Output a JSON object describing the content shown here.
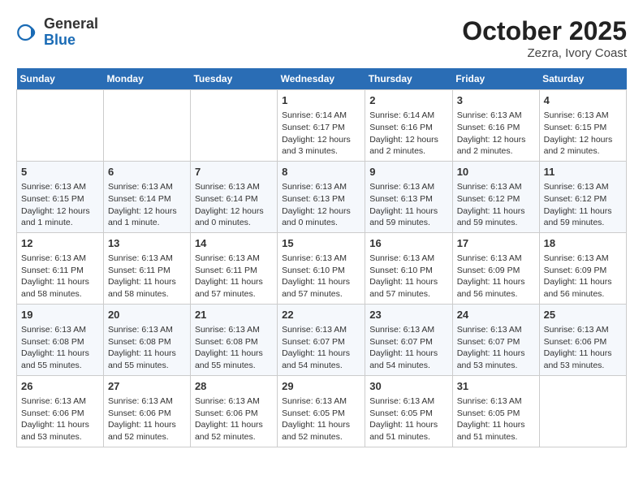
{
  "header": {
    "logo_general": "General",
    "logo_blue": "Blue",
    "month": "October 2025",
    "location": "Zezra, Ivory Coast"
  },
  "days_of_week": [
    "Sunday",
    "Monday",
    "Tuesday",
    "Wednesday",
    "Thursday",
    "Friday",
    "Saturday"
  ],
  "weeks": [
    [
      {
        "day": "",
        "info": ""
      },
      {
        "day": "",
        "info": ""
      },
      {
        "day": "",
        "info": ""
      },
      {
        "day": "1",
        "info": "Sunrise: 6:14 AM\nSunset: 6:17 PM\nDaylight: 12 hours and 3 minutes."
      },
      {
        "day": "2",
        "info": "Sunrise: 6:14 AM\nSunset: 6:16 PM\nDaylight: 12 hours and 2 minutes."
      },
      {
        "day": "3",
        "info": "Sunrise: 6:13 AM\nSunset: 6:16 PM\nDaylight: 12 hours and 2 minutes."
      },
      {
        "day": "4",
        "info": "Sunrise: 6:13 AM\nSunset: 6:15 PM\nDaylight: 12 hours and 2 minutes."
      }
    ],
    [
      {
        "day": "5",
        "info": "Sunrise: 6:13 AM\nSunset: 6:15 PM\nDaylight: 12 hours and 1 minute."
      },
      {
        "day": "6",
        "info": "Sunrise: 6:13 AM\nSunset: 6:14 PM\nDaylight: 12 hours and 1 minute."
      },
      {
        "day": "7",
        "info": "Sunrise: 6:13 AM\nSunset: 6:14 PM\nDaylight: 12 hours and 0 minutes."
      },
      {
        "day": "8",
        "info": "Sunrise: 6:13 AM\nSunset: 6:13 PM\nDaylight: 12 hours and 0 minutes."
      },
      {
        "day": "9",
        "info": "Sunrise: 6:13 AM\nSunset: 6:13 PM\nDaylight: 11 hours and 59 minutes."
      },
      {
        "day": "10",
        "info": "Sunrise: 6:13 AM\nSunset: 6:12 PM\nDaylight: 11 hours and 59 minutes."
      },
      {
        "day": "11",
        "info": "Sunrise: 6:13 AM\nSunset: 6:12 PM\nDaylight: 11 hours and 59 minutes."
      }
    ],
    [
      {
        "day": "12",
        "info": "Sunrise: 6:13 AM\nSunset: 6:11 PM\nDaylight: 11 hours and 58 minutes."
      },
      {
        "day": "13",
        "info": "Sunrise: 6:13 AM\nSunset: 6:11 PM\nDaylight: 11 hours and 58 minutes."
      },
      {
        "day": "14",
        "info": "Sunrise: 6:13 AM\nSunset: 6:11 PM\nDaylight: 11 hours and 57 minutes."
      },
      {
        "day": "15",
        "info": "Sunrise: 6:13 AM\nSunset: 6:10 PM\nDaylight: 11 hours and 57 minutes."
      },
      {
        "day": "16",
        "info": "Sunrise: 6:13 AM\nSunset: 6:10 PM\nDaylight: 11 hours and 57 minutes."
      },
      {
        "day": "17",
        "info": "Sunrise: 6:13 AM\nSunset: 6:09 PM\nDaylight: 11 hours and 56 minutes."
      },
      {
        "day": "18",
        "info": "Sunrise: 6:13 AM\nSunset: 6:09 PM\nDaylight: 11 hours and 56 minutes."
      }
    ],
    [
      {
        "day": "19",
        "info": "Sunrise: 6:13 AM\nSunset: 6:08 PM\nDaylight: 11 hours and 55 minutes."
      },
      {
        "day": "20",
        "info": "Sunrise: 6:13 AM\nSunset: 6:08 PM\nDaylight: 11 hours and 55 minutes."
      },
      {
        "day": "21",
        "info": "Sunrise: 6:13 AM\nSunset: 6:08 PM\nDaylight: 11 hours and 55 minutes."
      },
      {
        "day": "22",
        "info": "Sunrise: 6:13 AM\nSunset: 6:07 PM\nDaylight: 11 hours and 54 minutes."
      },
      {
        "day": "23",
        "info": "Sunrise: 6:13 AM\nSunset: 6:07 PM\nDaylight: 11 hours and 54 minutes."
      },
      {
        "day": "24",
        "info": "Sunrise: 6:13 AM\nSunset: 6:07 PM\nDaylight: 11 hours and 53 minutes."
      },
      {
        "day": "25",
        "info": "Sunrise: 6:13 AM\nSunset: 6:06 PM\nDaylight: 11 hours and 53 minutes."
      }
    ],
    [
      {
        "day": "26",
        "info": "Sunrise: 6:13 AM\nSunset: 6:06 PM\nDaylight: 11 hours and 53 minutes."
      },
      {
        "day": "27",
        "info": "Sunrise: 6:13 AM\nSunset: 6:06 PM\nDaylight: 11 hours and 52 minutes."
      },
      {
        "day": "28",
        "info": "Sunrise: 6:13 AM\nSunset: 6:06 PM\nDaylight: 11 hours and 52 minutes."
      },
      {
        "day": "29",
        "info": "Sunrise: 6:13 AM\nSunset: 6:05 PM\nDaylight: 11 hours and 52 minutes."
      },
      {
        "day": "30",
        "info": "Sunrise: 6:13 AM\nSunset: 6:05 PM\nDaylight: 11 hours and 51 minutes."
      },
      {
        "day": "31",
        "info": "Sunrise: 6:13 AM\nSunset: 6:05 PM\nDaylight: 11 hours and 51 minutes."
      },
      {
        "day": "",
        "info": ""
      }
    ]
  ]
}
